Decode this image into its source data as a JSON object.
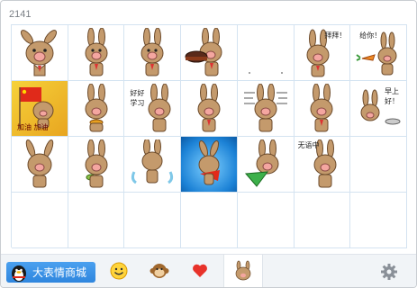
{
  "pack": {
    "count_label": "2141"
  },
  "stickers": [
    {
      "icon": "rabbit-waving-icon",
      "caption": ""
    },
    {
      "icon": "rabbit-thinking-icon",
      "caption": ""
    },
    {
      "icon": "rabbit-standing-icon",
      "caption": ""
    },
    {
      "icon": "rabbit-cake-icon",
      "caption": ""
    },
    {
      "icon": "blank-sticker-icon",
      "caption": ""
    },
    {
      "icon": "rabbit-bye-icon",
      "caption": "拜拜！"
    },
    {
      "icon": "rabbit-carrot-icon",
      "caption": "给你！"
    },
    {
      "icon": "rabbit-flag-icon",
      "caption": "加油  加油"
    },
    {
      "icon": "rabbit-burger-icon",
      "caption": ""
    },
    {
      "icon": "rabbit-hello-icon",
      "caption": "好好学习"
    },
    {
      "icon": "rabbit-plain-icon",
      "caption": ""
    },
    {
      "icon": "rabbit-lines-icon",
      "caption": ""
    },
    {
      "icon": "rabbit-walking-icon",
      "caption": ""
    },
    {
      "icon": "rabbit-sign-icon",
      "caption": "早上好！"
    },
    {
      "icon": "rabbit-shy-icon",
      "caption": ""
    },
    {
      "icon": "rabbit-drink-icon",
      "caption": ""
    },
    {
      "icon": "rabbit-dance-icon",
      "caption": ""
    },
    {
      "icon": "rabbit-hero-icon",
      "caption": ""
    },
    {
      "icon": "rabbit-fan-icon",
      "caption": ""
    },
    {
      "icon": "rabbit-speechless-icon",
      "caption": "无语中"
    }
  ],
  "bottom_bar": {
    "store_label": "大表情商城"
  }
}
